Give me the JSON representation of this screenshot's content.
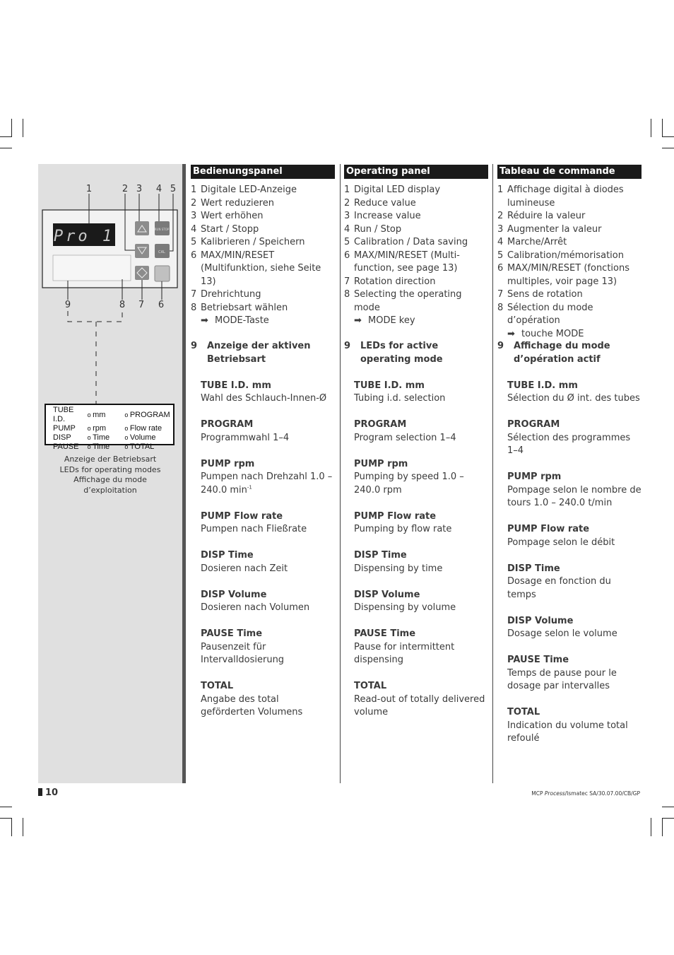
{
  "figure": {
    "callouts": [
      "1",
      "2",
      "3",
      "4",
      "5",
      "9",
      "8",
      "7",
      "6"
    ],
    "display_text": "Pro 1",
    "keys": {
      "run_stop": "RUN STOP",
      "cal": "CAL",
      "mode": "MODE"
    },
    "led_table": [
      [
        "TUBE I.D.",
        "mm",
        "PROGRAM"
      ],
      [
        "PUMP",
        "rpm",
        "Flow rate"
      ],
      [
        "DISP",
        "Time",
        "Volume"
      ],
      [
        "PAUSE",
        "Time",
        "TOTAL"
      ]
    ],
    "caption": [
      "Anzeige der Betriebsart",
      "LEDs for operating modes",
      "Affichage du mode",
      "d’exploitation"
    ]
  },
  "columns": [
    {
      "header": "Bedienungspanel",
      "items": [
        {
          "num": "1",
          "text": "Digitale LED-Anzeige"
        },
        {
          "num": "2",
          "text": "Wert reduzieren"
        },
        {
          "num": "3",
          "text": "Wert erhöhen"
        },
        {
          "num": "4",
          "text": "Start / Stopp"
        },
        {
          "num": "5",
          "text": "Kalibrieren / Speichern"
        },
        {
          "num": "6",
          "text": "MAX/MIN/RESET (Multifunktion, siehe Seite 13)"
        },
        {
          "num": "7",
          "text": "Drehrichtung"
        },
        {
          "num": "8",
          "text": "Betriebsart wählen"
        }
      ],
      "arrow_text": "MODE-Taste",
      "section": {
        "num": "9",
        "title": "Anzeige der aktiven Betriebsart"
      },
      "subs": [
        {
          "title": "TUBE I.D. mm",
          "text": "Wahl des Schlauch-Innen-Ø"
        },
        {
          "title": "PROGRAM",
          "text": "Programmwahl 1–4"
        },
        {
          "title": "PUMP rpm",
          "text": "Pumpen nach Drehzahl 1.0 – 240.0 min",
          "sup": "-1"
        },
        {
          "title": "PUMP Flow rate",
          "text": "Pumpen nach Fließrate"
        },
        {
          "title": "DISP Time",
          "text": "Dosieren nach Zeit"
        },
        {
          "title": "DISP Volume",
          "text": "Dosieren nach Volumen"
        },
        {
          "title": "PAUSE Time",
          "text": "Pausenzeit für Intervalldosierung"
        },
        {
          "title": "TOTAL",
          "text": "Angabe des total geförderten Volumens"
        }
      ]
    },
    {
      "header": "Operating panel",
      "items": [
        {
          "num": "1",
          "text": "Digital LED display"
        },
        {
          "num": "2",
          "text": "Reduce value"
        },
        {
          "num": "3",
          "text": "Increase value"
        },
        {
          "num": "4",
          "text": "Run / Stop"
        },
        {
          "num": "5",
          "text": "Calibration / Data saving"
        },
        {
          "num": "6",
          "text": "MAX/MIN/RESET (Multi-function, see page 13)"
        },
        {
          "num": "7",
          "text": "Rotation direction"
        },
        {
          "num": "8",
          "text": "Selecting the operating mode"
        }
      ],
      "arrow_text": "MODE key",
      "section": {
        "num": "9",
        "title": "LEDs for active operating mode"
      },
      "subs": [
        {
          "title": "TUBE I.D. mm",
          "text": "Tubing i.d. selection"
        },
        {
          "title": "PROGRAM",
          "text": "Program selection 1–4"
        },
        {
          "title": "PUMP rpm",
          "text": "Pumping by speed 1.0 – 240.0 rpm"
        },
        {
          "title": "PUMP Flow rate",
          "text": "Pumping by flow rate"
        },
        {
          "title": "DISP Time",
          "text": "Dispensing by time"
        },
        {
          "title": "DISP Volume",
          "text": "Dispensing by volume"
        },
        {
          "title": "PAUSE Time",
          "text": "Pause for intermittent dispensing"
        },
        {
          "title": "TOTAL",
          "text": "Read-out of totally delivered volume"
        }
      ]
    },
    {
      "header": "Tableau de commande",
      "items": [
        {
          "num": "1",
          "text": "Affichage digital à diodes lumineuse"
        },
        {
          "num": "2",
          "text": "Réduire la valeur"
        },
        {
          "num": "3",
          "text": "Augmenter la valeur"
        },
        {
          "num": "4",
          "text": "Marche/Arrêt"
        },
        {
          "num": "5",
          "text": "Calibration/mémorisation"
        },
        {
          "num": "6",
          "text": "MAX/MIN/RESET (fonctions multiples, voir page 13)"
        },
        {
          "num": "7",
          "text": "Sens de rotation"
        },
        {
          "num": "8",
          "text": "Sélection du mode d’opération"
        }
      ],
      "arrow_text": "touche MODE",
      "section": {
        "num": "9",
        "title": "Affichage du mode d’opération actif"
      },
      "subs": [
        {
          "title": "TUBE I.D. mm",
          "text": "Sélection du Ø int. des tubes"
        },
        {
          "title": "PROGRAM",
          "text": "Sélection des programmes 1–4"
        },
        {
          "title": "PUMP rpm",
          "text": "Pompage selon le nombre de tours 1.0 – 240.0 t/min"
        },
        {
          "title": "PUMP Flow rate",
          "text": "Pompage selon le débit"
        },
        {
          "title": "DISP Time",
          "text": "Dosage en fonction du temps"
        },
        {
          "title": "DISP Volume",
          "text": "Dosage selon le volume"
        },
        {
          "title": "PAUSE Time",
          "text": "Temps de pause pour le dosage par intervalles"
        },
        {
          "title": "TOTAL",
          "text": "Indication du volume total refoulé"
        }
      ]
    }
  ],
  "page_number": "10",
  "footer": {
    "prefix": "MCP ",
    "italic": "Process",
    "suffix": "/Ismatec SA/30.07.00/CB/GP"
  }
}
